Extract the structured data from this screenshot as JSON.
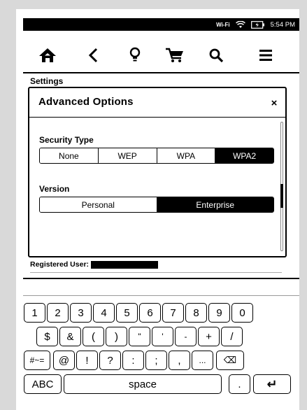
{
  "status": {
    "wifi_label": "Wi-Fi",
    "time": "5:54 PM"
  },
  "toolbar": {
    "home": "home-icon",
    "back": "back-icon",
    "light": "light-bulb-icon",
    "store": "cart-icon",
    "search": "search-icon",
    "menu": "menu-icon"
  },
  "page": {
    "title": "Settings"
  },
  "dialog": {
    "title": "Advanced Options",
    "close": "×",
    "security": {
      "label": "Security Type",
      "options": [
        "None",
        "WEP",
        "WPA",
        "WPA2"
      ],
      "selected": "WPA2"
    },
    "version": {
      "label": "Version",
      "options": [
        "Personal",
        "Enterprise"
      ],
      "selected": "Enterprise"
    }
  },
  "registered": {
    "label": "Registered User:"
  },
  "keyboard": {
    "row1": [
      "1",
      "2",
      "3",
      "4",
      "5",
      "6",
      "7",
      "8",
      "9",
      "0"
    ],
    "row2": [
      "$",
      "&",
      "(",
      ")",
      "\"",
      "'",
      "-",
      "+",
      "/"
    ],
    "row3": [
      "#~=",
      "@",
      "!",
      "?",
      ":",
      ";",
      ",",
      "...",
      "⌫"
    ],
    "row4": [
      "ABC",
      "space",
      ".",
      "↵"
    ]
  }
}
